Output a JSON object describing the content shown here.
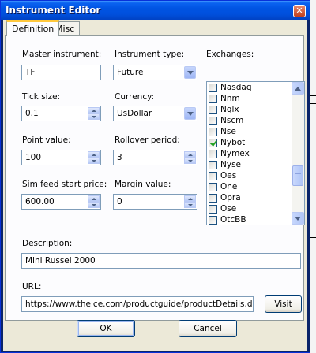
{
  "window": {
    "title": "Instrument Editor",
    "close_glyph": "✕"
  },
  "tabs": [
    {
      "label": "Definition",
      "active": true
    },
    {
      "label": "Misc",
      "active": false
    }
  ],
  "fields": {
    "master_instrument": {
      "label": "Master instrument:",
      "value": "TF"
    },
    "instrument_type": {
      "label": "Instrument type:",
      "value": "Future"
    },
    "tick_size": {
      "label": "Tick size:",
      "value": "0.1"
    },
    "currency": {
      "label": "Currency:",
      "value": "UsDollar"
    },
    "point_value": {
      "label": "Point value:",
      "value": "100"
    },
    "rollover_period": {
      "label": "Rollover period:",
      "value": "3"
    },
    "sim_feed_start_price": {
      "label": "Sim feed start price:",
      "value": "600.00"
    },
    "margin_value": {
      "label": "Margin value:",
      "value": "0"
    },
    "description": {
      "label": "Description:",
      "value": "Mini Russel 2000"
    },
    "url": {
      "label": "URL:",
      "value": "https://www.theice.com/productguide/productDetails.do?produ"
    }
  },
  "exchanges": {
    "label": "Exchanges:",
    "items": [
      {
        "name": "Nasdaq",
        "checked": false
      },
      {
        "name": "Nnm",
        "checked": false
      },
      {
        "name": "Nqlx",
        "checked": false
      },
      {
        "name": "Nscm",
        "checked": false
      },
      {
        "name": "Nse",
        "checked": false
      },
      {
        "name": "Nybot",
        "checked": true
      },
      {
        "name": "Nymex",
        "checked": false
      },
      {
        "name": "Nyse",
        "checked": false
      },
      {
        "name": "Oes",
        "checked": false
      },
      {
        "name": "One",
        "checked": false
      },
      {
        "name": "Opra",
        "checked": false
      },
      {
        "name": "Ose",
        "checked": false
      },
      {
        "name": "OtcBB",
        "checked": false
      }
    ]
  },
  "buttons": {
    "visit": "Visit",
    "ok": "OK",
    "cancel": "Cancel"
  },
  "colors": {
    "titlebar": "#0054e3",
    "dialog_bg": "#ece9d8",
    "panel_bg": "#fcfcfe",
    "checked_mark": "#21a121",
    "tab_highlight": "#ffc83c"
  }
}
